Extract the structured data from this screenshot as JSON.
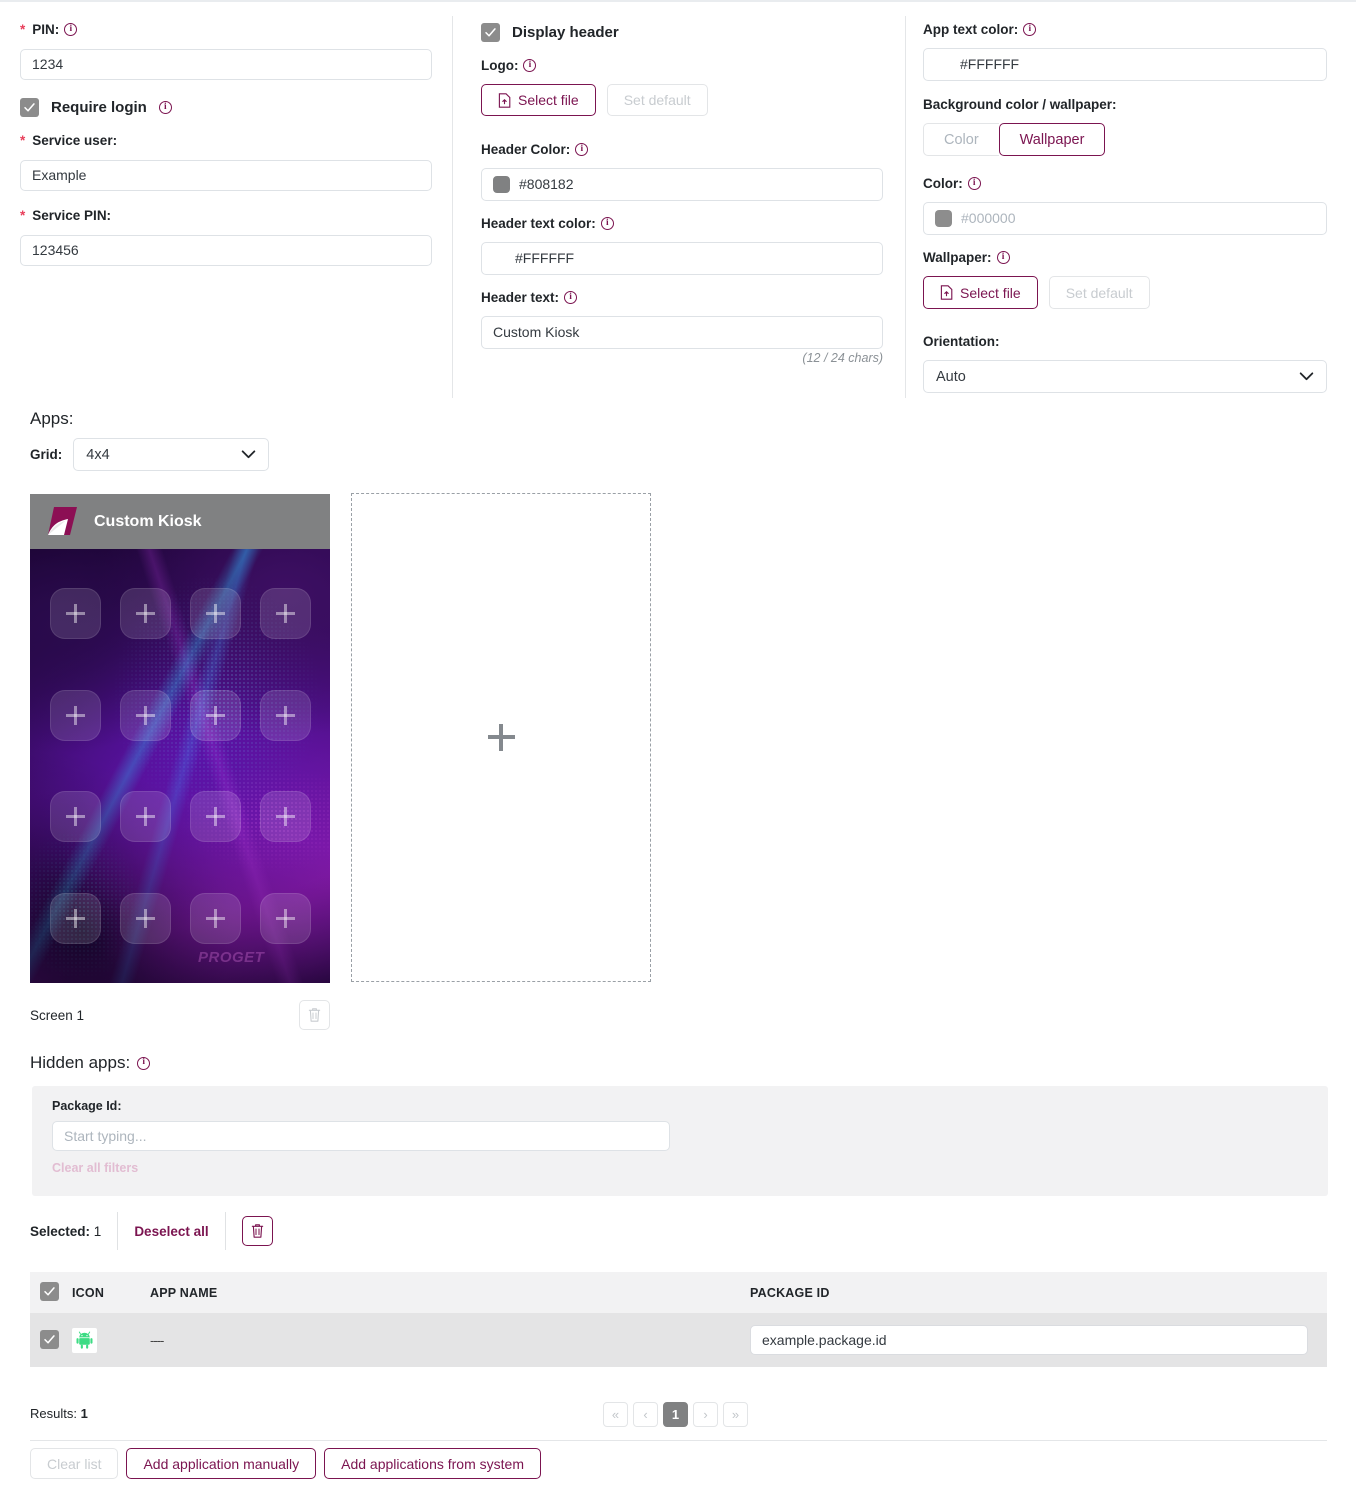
{
  "left_column": {
    "pin": {
      "label": "PIN:",
      "required": true,
      "value": "1234",
      "info": "info-icon"
    },
    "require_login": {
      "label": "Require login",
      "checked": true,
      "info": "info-icon"
    },
    "service_user": {
      "label": "Service user:",
      "required": true,
      "value": "Example"
    },
    "service_pin": {
      "label": "Service PIN:",
      "required": true,
      "value": "123456"
    }
  },
  "middle_column": {
    "display_header": {
      "label": "Display header",
      "checked": true
    },
    "logo": {
      "label": "Logo:",
      "select_file_label": "Select file",
      "set_default_label": "Set default",
      "set_default_disabled": true
    },
    "header_color": {
      "label": "Header Color:",
      "value": "#808182",
      "swatch": "#808182"
    },
    "header_text_color": {
      "label": "Header text color:",
      "value": "#FFFFFF"
    },
    "header_text": {
      "label": "Header text:",
      "value": "Custom Kiosk",
      "counter": "(12 / 24 chars)"
    }
  },
  "right_column": {
    "app_text_color": {
      "label": "App text color:",
      "value": "#FFFFFF"
    },
    "background": {
      "label": "Background color / wallpaper:",
      "options": [
        "Color",
        "Wallpaper"
      ],
      "selected": "Wallpaper"
    },
    "color": {
      "label": "Color:",
      "placeholder": "#000000",
      "swatch": "#8d8d8d"
    },
    "wallpaper": {
      "label": "Wallpaper:",
      "select_file_label": "Select file",
      "set_default_label": "Set default",
      "set_default_disabled": true
    },
    "orientation": {
      "label": "Orientation:",
      "value": "Auto",
      "options": [
        "Auto"
      ]
    }
  },
  "apps": {
    "title": "Apps:",
    "grid_label": "Grid:",
    "grid_value": "4x4",
    "grid_options": [
      "4x4"
    ],
    "preview": {
      "header_text": "Custom Kiosk",
      "header_color": "#808182",
      "header_text_color": "#FFFFFF",
      "watermark": "PROGET",
      "slot_count": 16
    },
    "screen_label": "Screen 1",
    "delete_screen_icon": "trash-icon",
    "add_screen_icon": "plus-icon"
  },
  "hidden_apps": {
    "title": "Hidden apps:",
    "filter": {
      "package_id_label": "Package Id:",
      "package_id_placeholder": "Start typing...",
      "package_id_value": "",
      "clear_filters_label": "Clear all filters"
    },
    "selection": {
      "selected_label": "Selected:",
      "selected_count": "1",
      "deselect_all_label": "Deselect all",
      "delete_icon": "trash-icon"
    },
    "table": {
      "header_checkbox_checked": true,
      "columns": [
        "ICON",
        "APP NAME",
        "PACKAGE ID"
      ],
      "rows": [
        {
          "checked": true,
          "icon": "android-icon",
          "app_name": "----",
          "package_id": "example.package.id"
        }
      ]
    },
    "results_label": "Results:",
    "results_count": "1",
    "pagination": {
      "first": "«",
      "prev": "‹",
      "current": "1",
      "next": "›",
      "last": "»"
    },
    "buttons": {
      "clear_list": "Clear list",
      "clear_list_disabled": true,
      "add_manually": "Add application manually",
      "add_from_system": "Add applications from system"
    }
  },
  "theme": {
    "accent": "#7b1450",
    "required_star": "#e83e5a",
    "checkbox_fill": "#8c8c8c",
    "panel_bg": "#f2f2f3",
    "row_bg": "#e4e4e5"
  }
}
